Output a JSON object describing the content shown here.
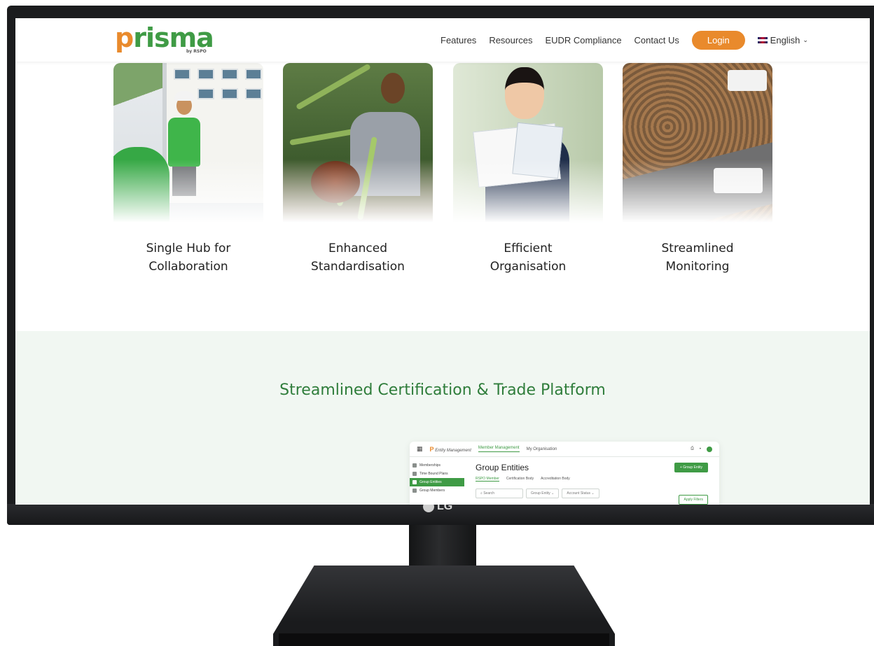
{
  "header": {
    "brand_word": "prisma",
    "brand_sub": "by RSPO",
    "nav": [
      "Features",
      "Resources",
      "EUDR Compliance",
      "Contact Us"
    ],
    "login_label": "Login",
    "language": "English"
  },
  "features": [
    {
      "label_line1": "Single Hub for",
      "label_line2": "Collaboration"
    },
    {
      "label_line1": "Enhanced",
      "label_line2": "Standardisation"
    },
    {
      "label_line1": "Efficient",
      "label_line2": "Organisation"
    },
    {
      "label_line1": "Streamlined",
      "label_line2": "Monitoring"
    }
  ],
  "section2": {
    "title": "Streamlined Certification & Trade Platform"
  },
  "app_preview": {
    "module": "Entity Management",
    "top_tabs": [
      "Member Management",
      "My Organisation"
    ],
    "sidebar": [
      "Memberships",
      "Time Bound Plans",
      "Group Entities",
      "Group Members"
    ],
    "heading": "Group Entities",
    "sub_tabs": [
      "RSPO Member",
      "Certification Body",
      "Accreditation Body"
    ],
    "search_placeholder": "Search",
    "filters": [
      "Group Entity",
      "Account Status"
    ],
    "add_button": "+ Group Entity",
    "apply_button": "Apply Filters"
  },
  "device": {
    "monitor_logo": "LG"
  },
  "colors": {
    "brand_green": "#3f9b45",
    "accent_orange": "#e98a2c",
    "section_bg": "#f1f7f2"
  }
}
